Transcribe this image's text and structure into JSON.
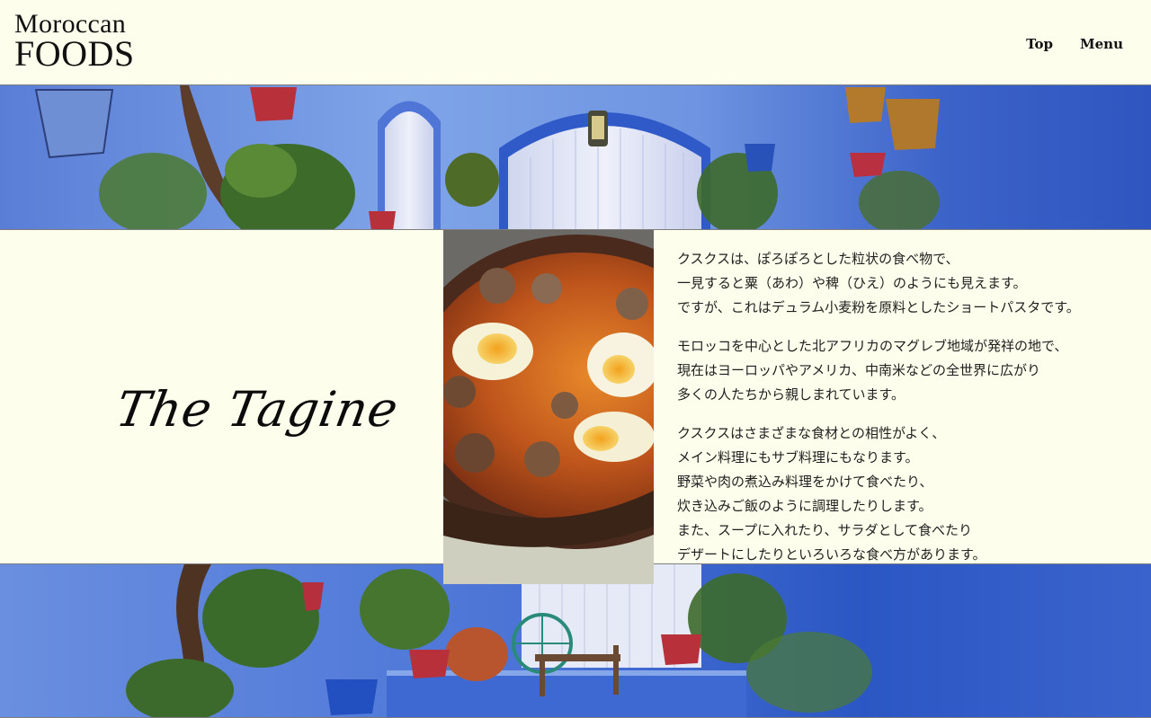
{
  "header": {
    "logo_line1": "Moroccan",
    "logo_line2": "FOODS",
    "nav": [
      "Top",
      "Menu"
    ]
  },
  "section": {
    "title": "The Tagine",
    "paragraphs": [
      "クスクスは、ぽろぽろとした粒状の食べ物で、\n一見すると粟（あわ）や稗（ひえ）のようにも見えます。\nですが、これはデュラム小麦粉を原料としたショートパスタです。",
      "モロッコを中心とした北アフリカのマグレブ地域が発祥の地で、\n現在はヨーロッパやアメリカ、中南米などの全世界に広がり\n多くの人たちから親しまれています。",
      "クスクスはさまざまな食材との相性がよく、\nメイン料理にもサブ料理にもなります。\n野菜や肉の煮込み料理をかけて食べたり、\n炊き込みご飯のように調理したりします。\nまた、スープに入れたり、サラダとして食べたり\nデザートにしたりといろいろな食べ方があります。"
    ]
  },
  "colors": {
    "page_background": "#fefeec",
    "wall_blue": "#3f63c9",
    "text": "#1f1f1f"
  }
}
